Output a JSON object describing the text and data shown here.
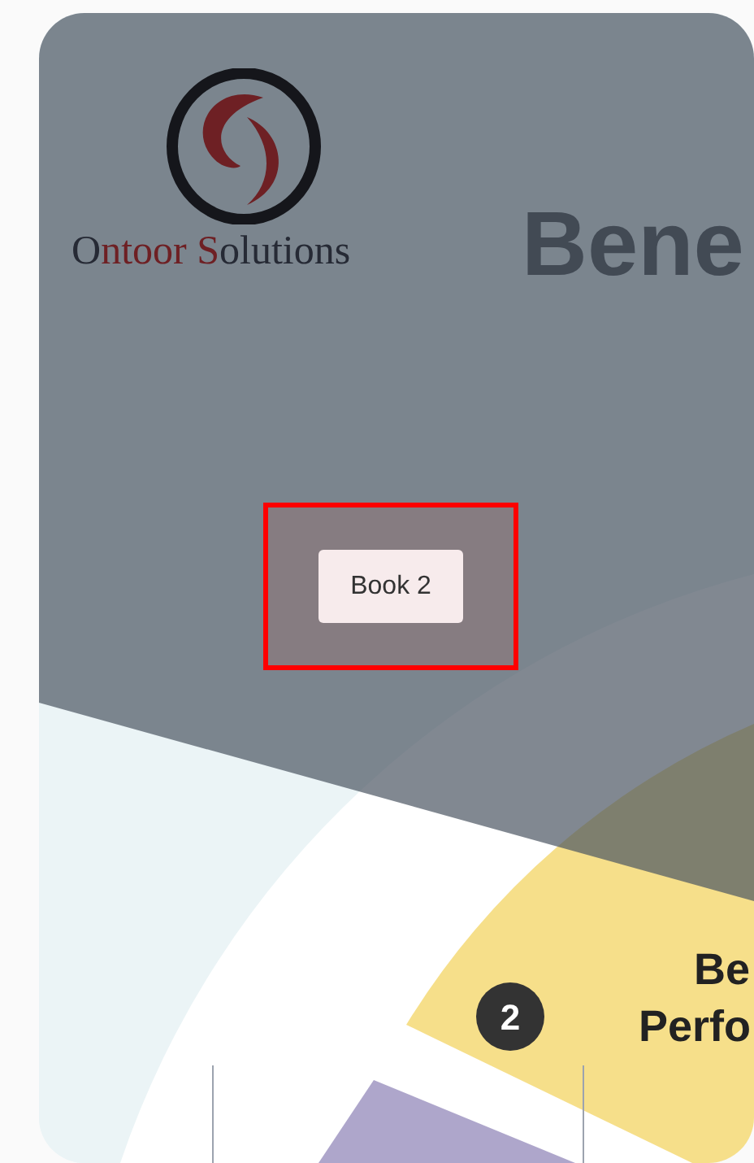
{
  "slide": {
    "logo_text": [
      {
        "text": "O",
        "color": "#262a35"
      },
      {
        "text": "ntoor S",
        "color": "#6e2024"
      },
      {
        "text": "olutions",
        "color": "#262a35"
      }
    ],
    "heading": "Bene",
    "step_number": "2",
    "step_title": [
      "Be",
      "Perfo"
    ]
  },
  "highlight": {
    "button": "Book 2"
  }
}
